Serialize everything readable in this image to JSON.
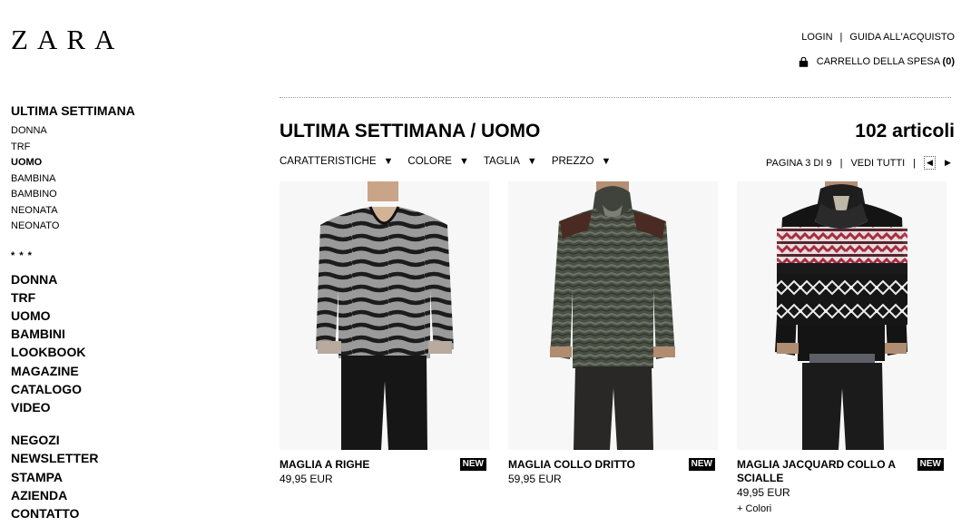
{
  "brand": {
    "logo": "ZARA"
  },
  "header": {
    "login": "LOGIN",
    "separator": "|",
    "guide": "GUIDA ALL'ACQUISTO",
    "cart_label": "CARRELLO DELLA SPESA",
    "cart_count": "(0)",
    "cart_icon": "shopping-bag-icon"
  },
  "sidebar": {
    "section_title": "ULTIMA SETTIMANA",
    "sub_items": [
      "DONNA",
      "TRF",
      "UOMO",
      "BAMBINA",
      "BAMBINO",
      "NEONATA",
      "NEONATO"
    ],
    "active_sub": "UOMO",
    "stars": "* * *",
    "main_nav": [
      "DONNA",
      "TRF",
      "UOMO",
      "BAMBINI",
      "LOOKBOOK",
      "MAGAZINE",
      "CATALOGO",
      "VIDEO"
    ],
    "secondary_nav": [
      "NEGOZI",
      "NEWSLETTER",
      "STAMPA",
      "AZIENDA",
      "CONTATTO"
    ]
  },
  "main": {
    "title": "ULTIMA SETTIMANA / UOMO",
    "count": "102 articoli",
    "filters": [
      "CARATTERISTICHE",
      "COLORE",
      "TAGLIA",
      "PREZZO"
    ],
    "filter_icon": "triangle-down-icon",
    "pager": {
      "page": "PAGINA 3 DI 9",
      "sep": "|",
      "see_all": "VEDI TUTTI",
      "prev_icon": "triangle-left-icon",
      "next_icon": "triangle-right-icon"
    },
    "products": [
      {
        "name": "MAGLIA A RIGHE",
        "price": "49,95 EUR",
        "badge": "NEW",
        "colors": ""
      },
      {
        "name": "MAGLIA COLLO DRITTO",
        "price": "59,95 EUR",
        "badge": "NEW",
        "colors": ""
      },
      {
        "name": "MAGLIA JACQUARD COLLO A SCIALLE",
        "price": "49,95 EUR",
        "badge": "NEW",
        "colors": "+ Colori"
      }
    ]
  }
}
